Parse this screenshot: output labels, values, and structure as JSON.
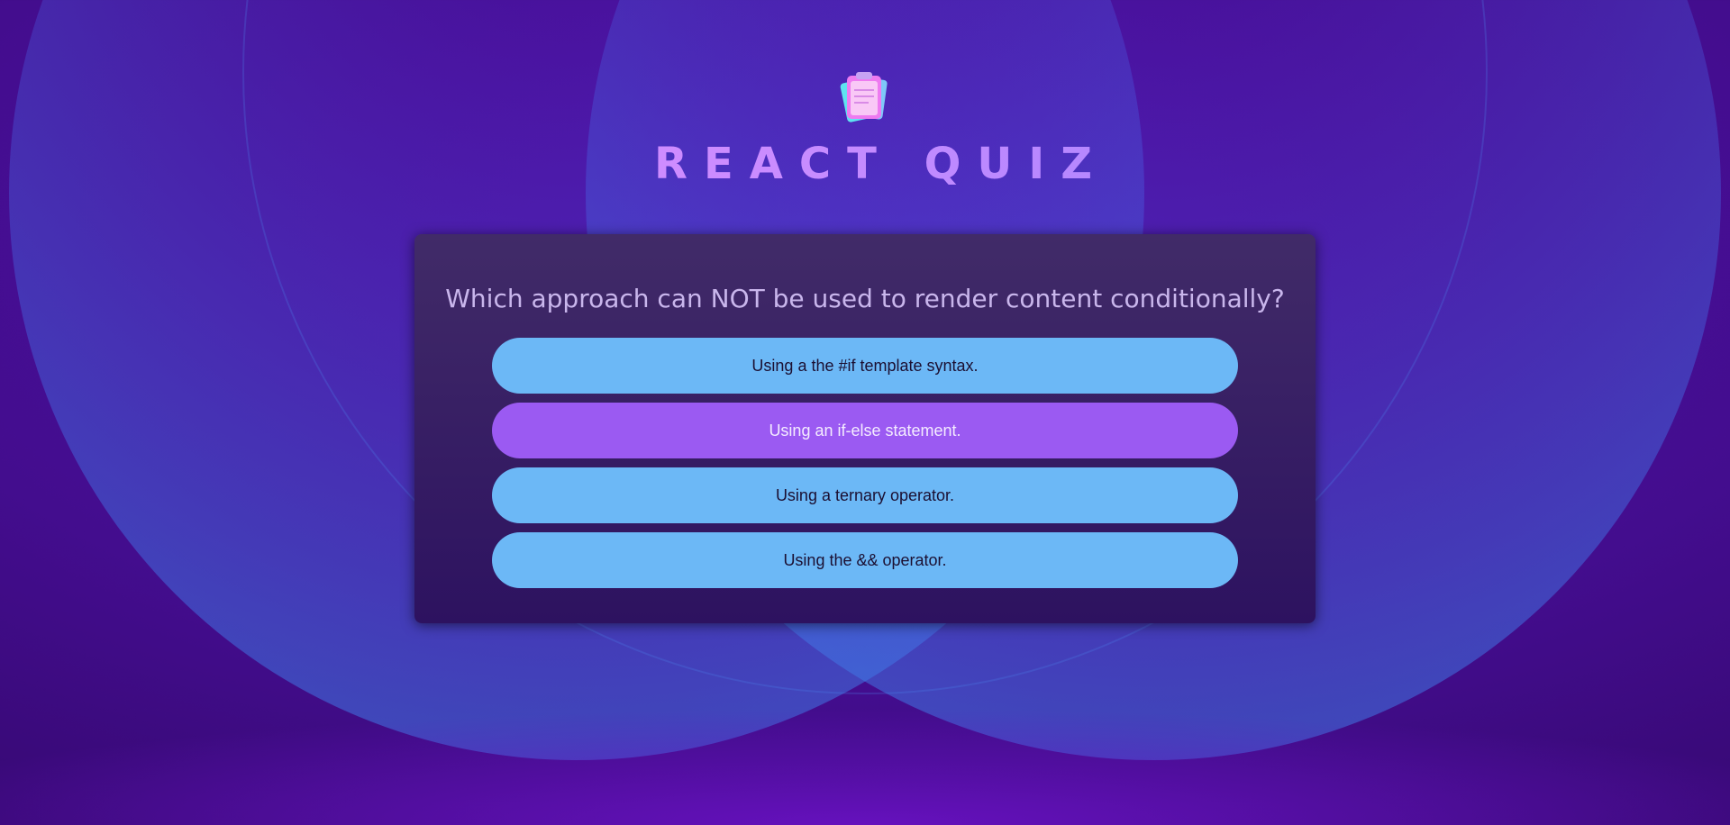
{
  "app": {
    "title": "REACT QUIZ",
    "logo_icon": "quiz-clipboard-logo-icon"
  },
  "colors": {
    "background": "#430d8e",
    "card": "#3a1f66",
    "answer_default": "#6cb8f6",
    "answer_selected": "#9b5af2",
    "title_gradient_start": "#e98bff",
    "title_gradient_end": "#8d7dff"
  },
  "quiz": {
    "question": "Which approach can NOT be used to render content conditionally?",
    "answers": [
      {
        "label": "Using a the #if template syntax.",
        "selected": false
      },
      {
        "label": "Using an if-else statement.",
        "selected": true
      },
      {
        "label": "Using a ternary operator.",
        "selected": false
      },
      {
        "label": "Using the && operator.",
        "selected": false
      }
    ]
  }
}
